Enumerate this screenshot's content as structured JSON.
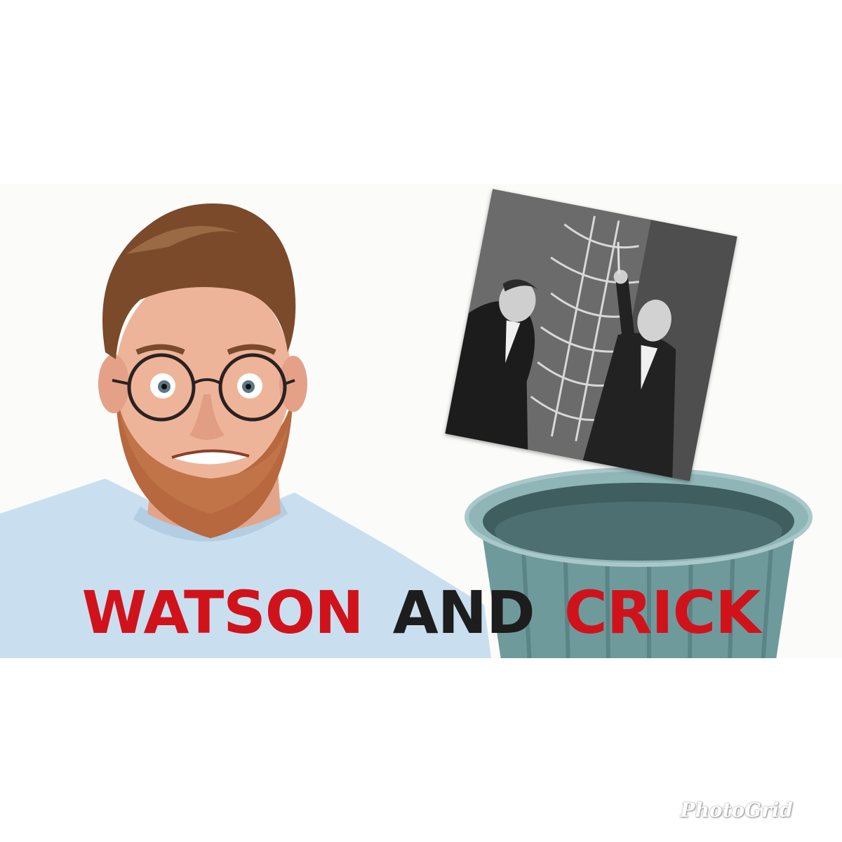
{
  "headline": {
    "word1": "WATSON",
    "word2": "AND",
    "word3": "CRICK"
  },
  "watermark": {
    "text": "PhotoGrid"
  },
  "colors": {
    "headline_red": "#d0131b",
    "headline_black": "#1d1d1d",
    "shirt": "#c9dff0",
    "trash_can": "#6f9a9c",
    "background": "#ffffff"
  },
  "images": {
    "person": "bearded man with round glasses and wide-eyed expression",
    "historic_photo": "black-and-white photograph of two men beside a DNA double helix model",
    "trash_can": "teal metal trash can"
  }
}
